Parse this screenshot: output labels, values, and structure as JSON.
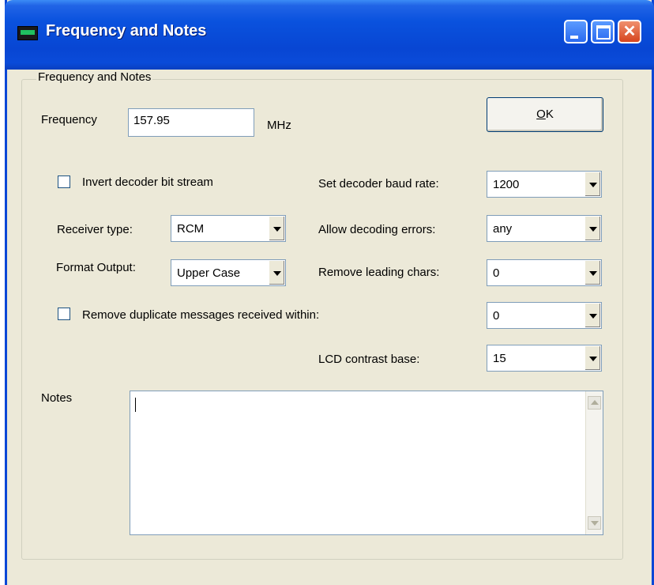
{
  "window": {
    "title": "Frequency and Notes",
    "icon": "lcd-icon",
    "controls": [
      "minimize-icon",
      "maximize-icon",
      "close-icon"
    ]
  },
  "group": {
    "label": "Frequency and Notes"
  },
  "frequency": {
    "label": "Frequency",
    "value": "157.95",
    "unit": "MHz"
  },
  "ok_button": {
    "label_underlined": "O",
    "label_rest": "K"
  },
  "invert": {
    "label": "Invert decoder bit stream",
    "checked": false
  },
  "baud_rate": {
    "label": "Set decoder baud rate:",
    "value": "1200"
  },
  "receiver_type": {
    "label": "Receiver type:",
    "value": "RCM"
  },
  "decoding_errors": {
    "label": "Allow decoding errors:",
    "value": "any"
  },
  "format_output": {
    "label": "Format Output:",
    "value": "Upper Case"
  },
  "leading_chars": {
    "label": "Remove leading chars:",
    "value": "0"
  },
  "duplicates": {
    "label": "Remove duplicate messages received within:",
    "value": "0",
    "checked": false
  },
  "lcd_contrast": {
    "label": "LCD contrast base:",
    "value": "15"
  },
  "notes": {
    "label": "Notes",
    "value": ""
  }
}
